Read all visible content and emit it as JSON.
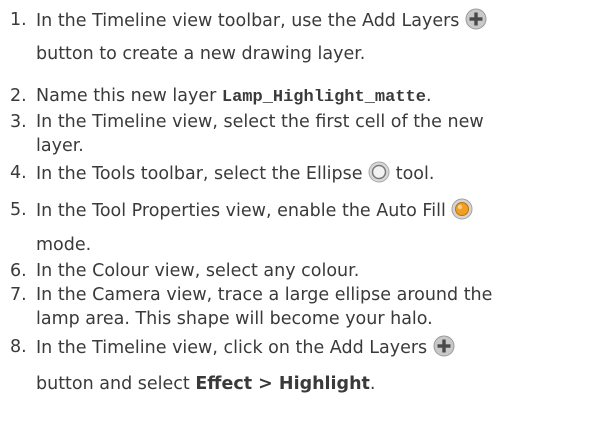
{
  "steps": [
    {
      "number": "1.",
      "text_a": "In the Timeline view toolbar, use the Add Layers",
      "text_b": "button to create a new drawing layer."
    },
    {
      "number": "2.",
      "text_a": "Name this new layer ",
      "code": "Lamp_Highlight_matte",
      "text_b": "."
    },
    {
      "number": "3.",
      "text_a": "In the Timeline view, select the first cell of the new",
      "text_b": "layer."
    },
    {
      "number": "4.",
      "text_a": "In the Tools toolbar, select the Ellipse",
      "text_b": "tool."
    },
    {
      "number": "5.",
      "text_a": "In the Tool Properties view, enable the Auto Fill",
      "text_b": "mode."
    },
    {
      "number": "6.",
      "text_a": "In the Colour view, select any colour."
    },
    {
      "number": "7.",
      "text_a": "In the Camera view, trace a large ellipse around the",
      "text_b": "lamp area. This shape will become your halo."
    },
    {
      "number": "8.",
      "text_a": "In the Timeline view, click on the Add Layers",
      "text_b": "button and select ",
      "bold": "Effect > Highlight",
      "text_c": "."
    }
  ],
  "icons": {
    "add_layers": "add-layers-icon",
    "ellipse": "ellipse-tool-icon",
    "auto_fill": "auto-fill-icon"
  }
}
